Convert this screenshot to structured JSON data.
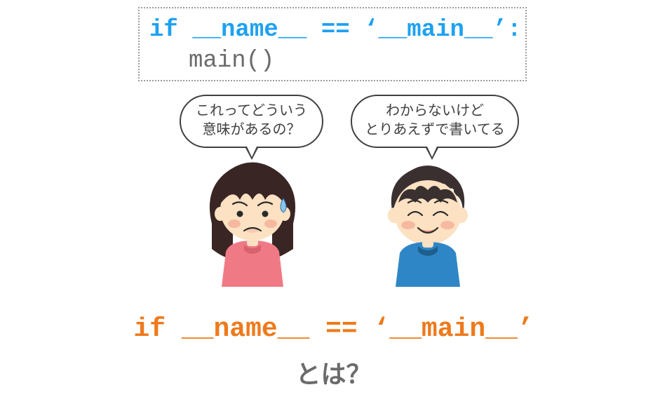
{
  "codebox": {
    "line1": "if __name__ == ‘__main__’:",
    "line2": "main()"
  },
  "bubbles": {
    "left": {
      "line1": "これってどういう",
      "line2": "意味があるの？"
    },
    "right": {
      "line1": "わからないけど",
      "line2": "とりあえずで書いてる"
    }
  },
  "title": {
    "code": "if __name__ == ‘__main__’",
    "question": "とは？"
  }
}
